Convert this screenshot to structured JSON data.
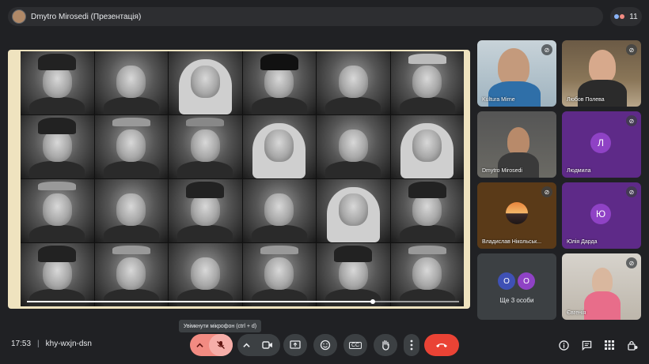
{
  "meeting": {
    "presenter_title": "Dmytro Mirosedi (Презентація)",
    "participant_count": "11",
    "time": "17:53",
    "separator": "|",
    "code": "khy-wxjn-dsn"
  },
  "presentation": {
    "progress_percent": 80
  },
  "participants": [
    {
      "name": "Kultura Mirne",
      "muted": true
    },
    {
      "name": "Любов Полева",
      "muted": true
    },
    {
      "name": "Dmytro Mirosedi",
      "muted": false
    },
    {
      "name": "Людмила",
      "initial": "Л",
      "muted": true
    },
    {
      "name": "Владислав Нікольськ...",
      "muted": true
    },
    {
      "name": "Юлія Дарда",
      "initial": "Ю",
      "muted": true
    },
    {
      "name": "Євгенія",
      "muted": true
    }
  ],
  "more_tile": {
    "label": "Ще 3 особи",
    "initial_1": "О",
    "initial_2": "О"
  },
  "tooltip": "Увімкнути мікрофон (ctrl + d)",
  "controls": {
    "expand_arrow": "^",
    "mic_icon": "mic-off-icon",
    "camera_icon": "camera-icon",
    "present_icon": "present-icon",
    "emoji_icon": "emoji-icon",
    "captions_icon": "captions-icon",
    "captions_label": "CC",
    "hand_icon": "raise-hand-icon",
    "more_icon": "more-vert-icon",
    "end_icon": "end-call-icon"
  },
  "colors": {
    "background": "#202124",
    "mic_muted": "#f28b82",
    "end_call": "#ea4335",
    "avatar_purple": "#8f42c5"
  }
}
